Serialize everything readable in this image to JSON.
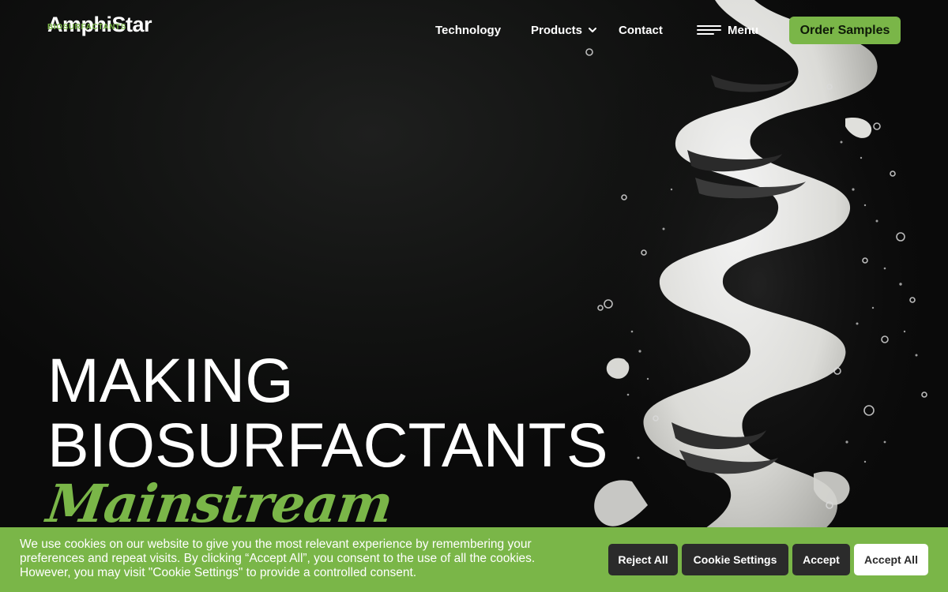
{
  "brand": {
    "name": "AmphiStar",
    "tagline": "BIOSURFACTANTS",
    "accent_color": "#7ab648"
  },
  "nav": {
    "technology": "Technology",
    "products": "Products",
    "contact": "Contact",
    "menu": "Menu",
    "order_button": "Order Samples"
  },
  "hero": {
    "line1": "MAKING",
    "line2": "BIOSURFACTANTS",
    "line3": "Mainstream",
    "image": "white foam spiral with bubbles on black background"
  },
  "cookie_bar": {
    "text": "We use cookies on our website to give you the most relevant experience by remembering your preferences and repeat visits. By clicking “Accept All”, you consent to the use of all the cookies. However, you may visit \"Cookie Settings\" to provide a controlled consent.",
    "reject_all": "Reject All",
    "cookie_settings": "Cookie Settings",
    "accept": "Accept",
    "accept_all": "Accept All"
  },
  "icons": [
    "chevron-down-icon",
    "hamburger-menu-icon"
  ]
}
